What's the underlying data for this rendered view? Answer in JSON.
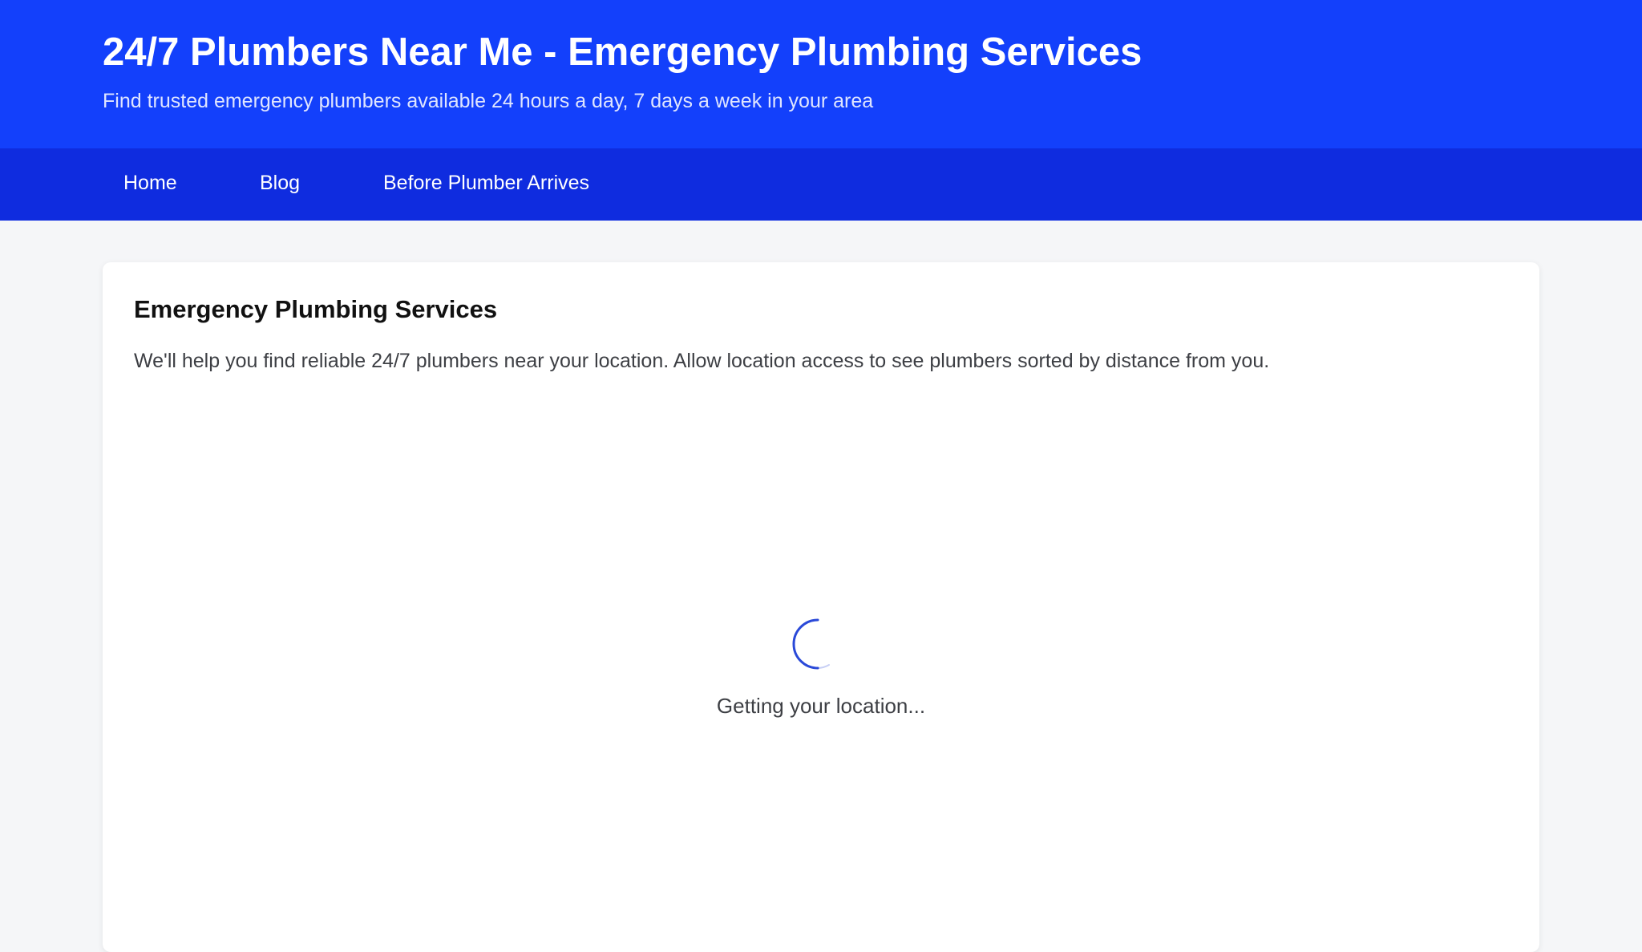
{
  "header": {
    "title": "24/7 Plumbers Near Me - Emergency Plumbing Services",
    "subtitle": "Find trusted emergency plumbers available 24 hours a day, 7 days a week in your area"
  },
  "nav": {
    "items": [
      {
        "label": "Home"
      },
      {
        "label": "Blog"
      },
      {
        "label": "Before Plumber Arrives"
      }
    ]
  },
  "main": {
    "heading": "Emergency Plumbing Services",
    "intro": "We'll help you find reliable 24/7 plumbers near your location. Allow location access to see plumbers sorted by distance from you.",
    "loading_text": "Getting your location...",
    "spinner_icon": "loading-spinner-icon"
  },
  "colors": {
    "header_bg": "#1340fb",
    "nav_bg": "#0f2cdf",
    "page_bg": "#f5f6f8",
    "spinner": "#1f3fd6"
  }
}
